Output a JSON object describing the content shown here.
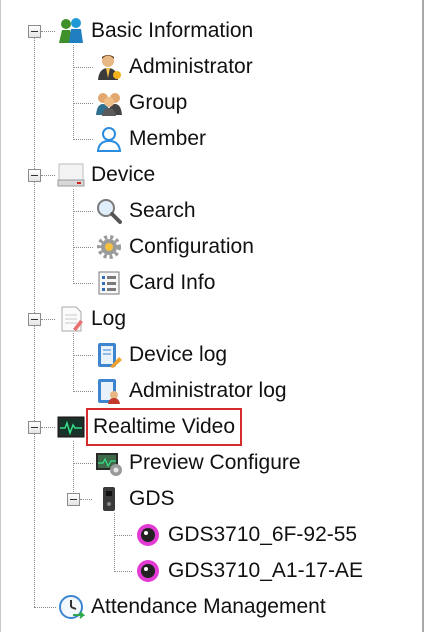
{
  "tree": {
    "basic_information": {
      "label": "Basic Information",
      "icon": "group-people-icon",
      "children": [
        "Administrator",
        "Group",
        "Member"
      ]
    },
    "device": {
      "label": "Device",
      "icon": "device-tray-icon",
      "children": [
        "Search",
        "Configuration",
        "Card Info"
      ]
    },
    "log": {
      "label": "Log",
      "icon": "document-icon",
      "children": [
        "Device log",
        "Administrator log"
      ]
    },
    "realtime_video": {
      "label": "Realtime Video",
      "icon": "monitor-waveform-icon",
      "selected": true,
      "children": {
        "preview_configure": "Preview Configure",
        "gds": {
          "label": "GDS",
          "cameras": [
            "GDS3710_6F-92-55",
            "GDS3710_A1-17-AE"
          ]
        }
      }
    },
    "attendance_management": {
      "label": "Attendance Management",
      "icon": "clock-icon"
    }
  },
  "colors": {
    "selection_border": "#d62c2c",
    "camera_pink": "#e23bd3"
  }
}
